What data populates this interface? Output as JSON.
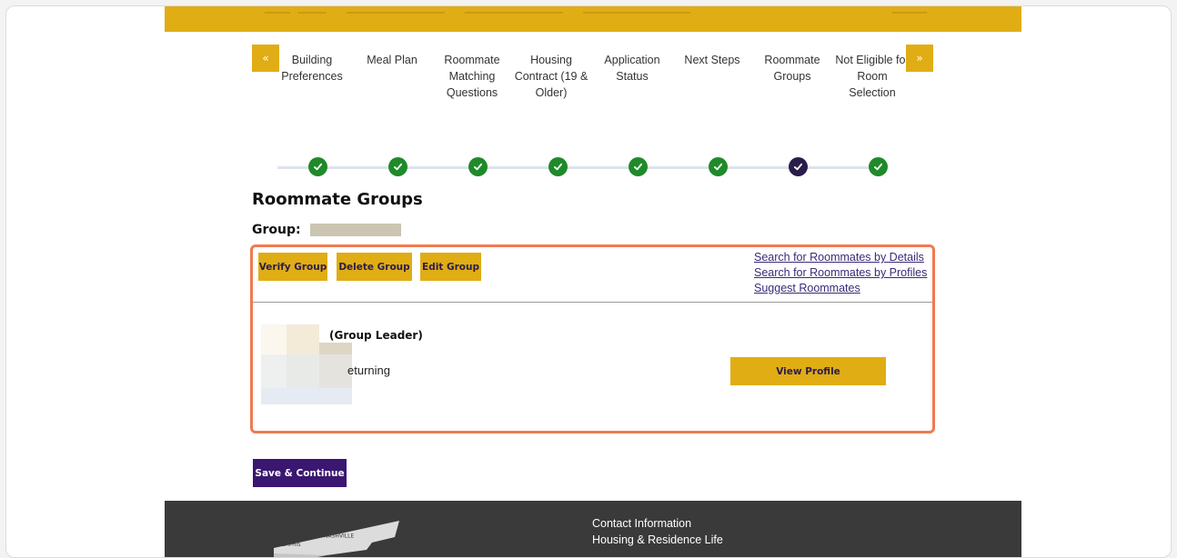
{
  "steps": {
    "prev_label": "«",
    "next_label": "»",
    "items": [
      {
        "label": "Building Preferences"
      },
      {
        "label": "Meal Plan"
      },
      {
        "label": "Roommate Matching Questions"
      },
      {
        "label": "Housing Contract (19 & Older)"
      },
      {
        "label": "Application Status"
      },
      {
        "label": "Next Steps"
      },
      {
        "label": "Roommate Groups"
      },
      {
        "label": "Not Eligible for Room Selection"
      }
    ]
  },
  "progress": {
    "states": [
      "done",
      "done",
      "done",
      "done",
      "done",
      "done",
      "current",
      "done"
    ]
  },
  "page": {
    "title": "Roommate Groups",
    "group_label": "Group:"
  },
  "actions": {
    "verify": "Verify Group",
    "delete": "Delete Group",
    "edit": "Edit Group"
  },
  "links": {
    "search_details": "Search for Roommates by Details",
    "search_profiles": "Search for Roommates by Profiles",
    "suggest": "Suggest Roommates"
  },
  "member": {
    "role": "(Group Leader)",
    "status": "eturning",
    "view_profile": "View Profile"
  },
  "save": {
    "label": "Save & Continue"
  },
  "footer": {
    "map_label": "NASHVILLE",
    "map_label2": "MEMPHIS",
    "contact_title": "Contact Information",
    "contact_dept": "Housing & Residence Life"
  },
  "colors": {
    "gold": "#e0ad15",
    "purple": "#3a1770",
    "green": "#1f8a2a",
    "highlight": "#f07a50"
  }
}
